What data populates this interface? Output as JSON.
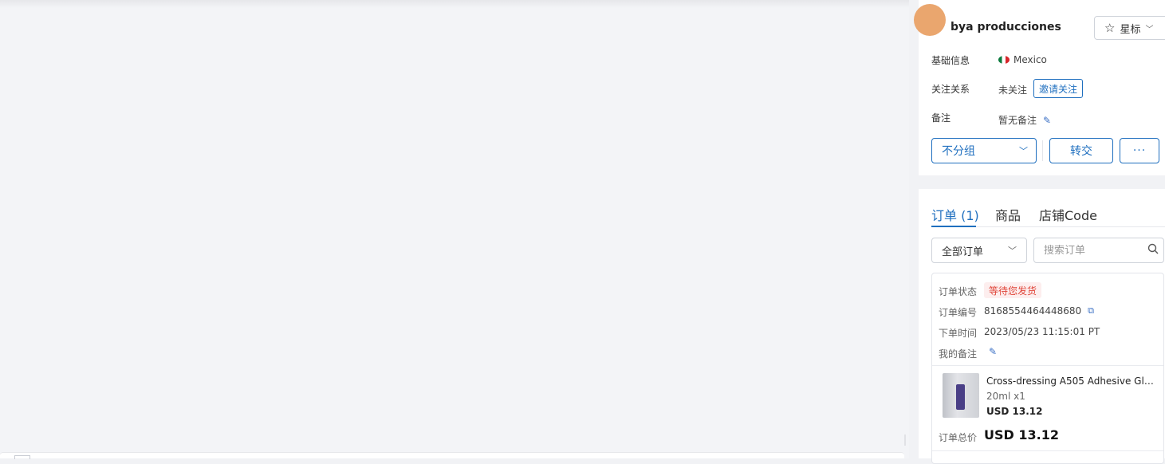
{
  "customer": {
    "name": "bya producciones",
    "star_label": "星标",
    "basic_info_label": "基础信息",
    "country": "Mexico",
    "follow_label": "关注关系",
    "follow_status": "未关注",
    "invite_button": "邀请关注",
    "remark_label": "备注",
    "remark_value": "暂无备注",
    "group_select": "不分组",
    "transfer_button": "转交",
    "more_button": "···"
  },
  "tabs": [
    {
      "label": "订单 (1)",
      "active": true
    },
    {
      "label": "商品",
      "active": false
    },
    {
      "label": "店铺Code",
      "active": false
    }
  ],
  "orders_filter": {
    "selected": "全部订单",
    "search_placeholder": "搜索订单"
  },
  "order": {
    "status_label": "订单状态",
    "status_value": "等待您发货",
    "number_label": "订单编号",
    "number_value": "8168554464448680",
    "time_label": "下单时间",
    "time_value": "2023/05/23 11:15:01 PT",
    "remark_label": "我的备注",
    "product": {
      "title": "Cross-dressing A505 Adhesive Glue ...",
      "spec": "20ml x1",
      "price": "USD 13.12"
    },
    "total_label": "订单总价",
    "total_value": "USD 13.12"
  },
  "colors": {
    "accent": "#1f6fbf",
    "status_text": "#e0463a",
    "status_bg": "#fdeeee",
    "avatar": "#eaa66e"
  }
}
